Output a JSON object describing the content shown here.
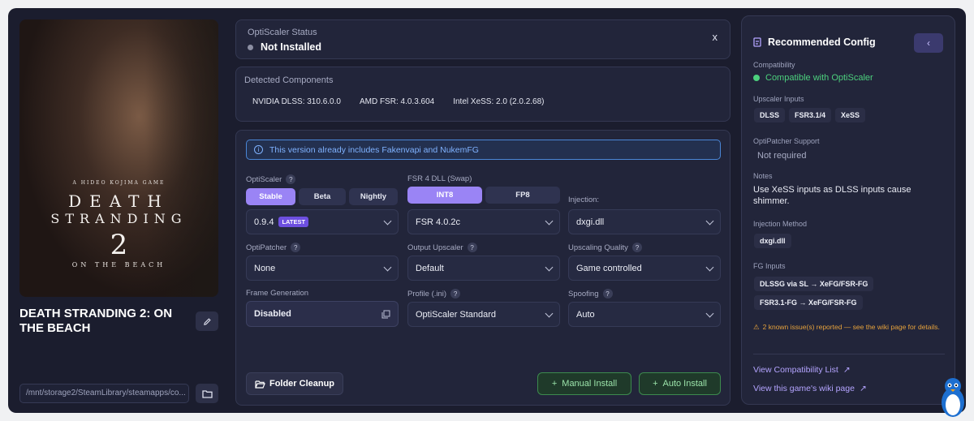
{
  "game": {
    "title": "DEATH STRANDING 2: ON THE BEACH",
    "path": "/mnt/storage2/SteamLibrary/steamapps/co...",
    "cover": {
      "line1": "A HIDEO KOJIMA GAME",
      "line2": "DEATH",
      "line3": "STRANDING",
      "line4": "2",
      "line5": "ON THE BEACH"
    }
  },
  "status": {
    "label": "OptiScaler Status",
    "value": "Not Installed",
    "close": "x"
  },
  "components": {
    "label": "Detected Components",
    "items": [
      "NVIDIA DLSS: 310.6.0.0",
      "AMD FSR: 4.0.3.604",
      "Intel XeSS: 2.0 (2.0.2.68)"
    ]
  },
  "banner": "This version already includes Fakenvapi and NukemFG",
  "opti": {
    "label": "OptiScaler",
    "channels": [
      "Stable",
      "Beta",
      "Nightly"
    ],
    "version": "0.9.4",
    "badge": "LATEST"
  },
  "fsr": {
    "label": "FSR 4 DLL (Swap)",
    "modes": [
      "INT8",
      "FP8"
    ],
    "value": "FSR 4.0.2c"
  },
  "injection": {
    "label": "Injection:",
    "value": "dxgi.dll"
  },
  "optipatcher": {
    "label": "OptiPatcher",
    "value": "None"
  },
  "upscaler": {
    "label": "Output Upscaler",
    "value": "Default"
  },
  "quality": {
    "label": "Upscaling Quality",
    "value": "Game controlled"
  },
  "framegen": {
    "label": "Frame Generation",
    "value": "Disabled"
  },
  "profile": {
    "label": "Profile (.ini)",
    "value": "OptiScaler Standard"
  },
  "spoofing": {
    "label": "Spoofing",
    "value": "Auto"
  },
  "actions": {
    "cleanup": "Folder Cleanup",
    "manual": "Manual Install",
    "auto": "Auto Install"
  },
  "rec": {
    "title": "Recommended Config",
    "collapse": "‹",
    "compat_label": "Compatibility",
    "compat_value": "Compatible with OptiScaler",
    "inputs_label": "Upscaler Inputs",
    "inputs": [
      "DLSS",
      "FSR3.1/4",
      "XeSS"
    ],
    "patcher_label": "OptiPatcher Support",
    "patcher_value": "Not required",
    "notes_label": "Notes",
    "notes": "Use XeSS inputs as DLSS inputs cause shimmer.",
    "inj_label": "Injection Method",
    "inj": "dxgi.dll",
    "fg_label": "FG Inputs",
    "fg": [
      "DLSSG via SL → XeFG/FSR-FG",
      "FSR3.1-FG → XeFG/FSR-FG"
    ],
    "issues": "2 known issue(s) reported — see the wiki page for details.",
    "link1": "View Compatibility List",
    "link2": "View this game's wiki page"
  },
  "colors": {
    "accent": "#9a84f5",
    "success": "#4cd07d",
    "warning": "#e6a23c",
    "info": "#7fb2ff"
  }
}
